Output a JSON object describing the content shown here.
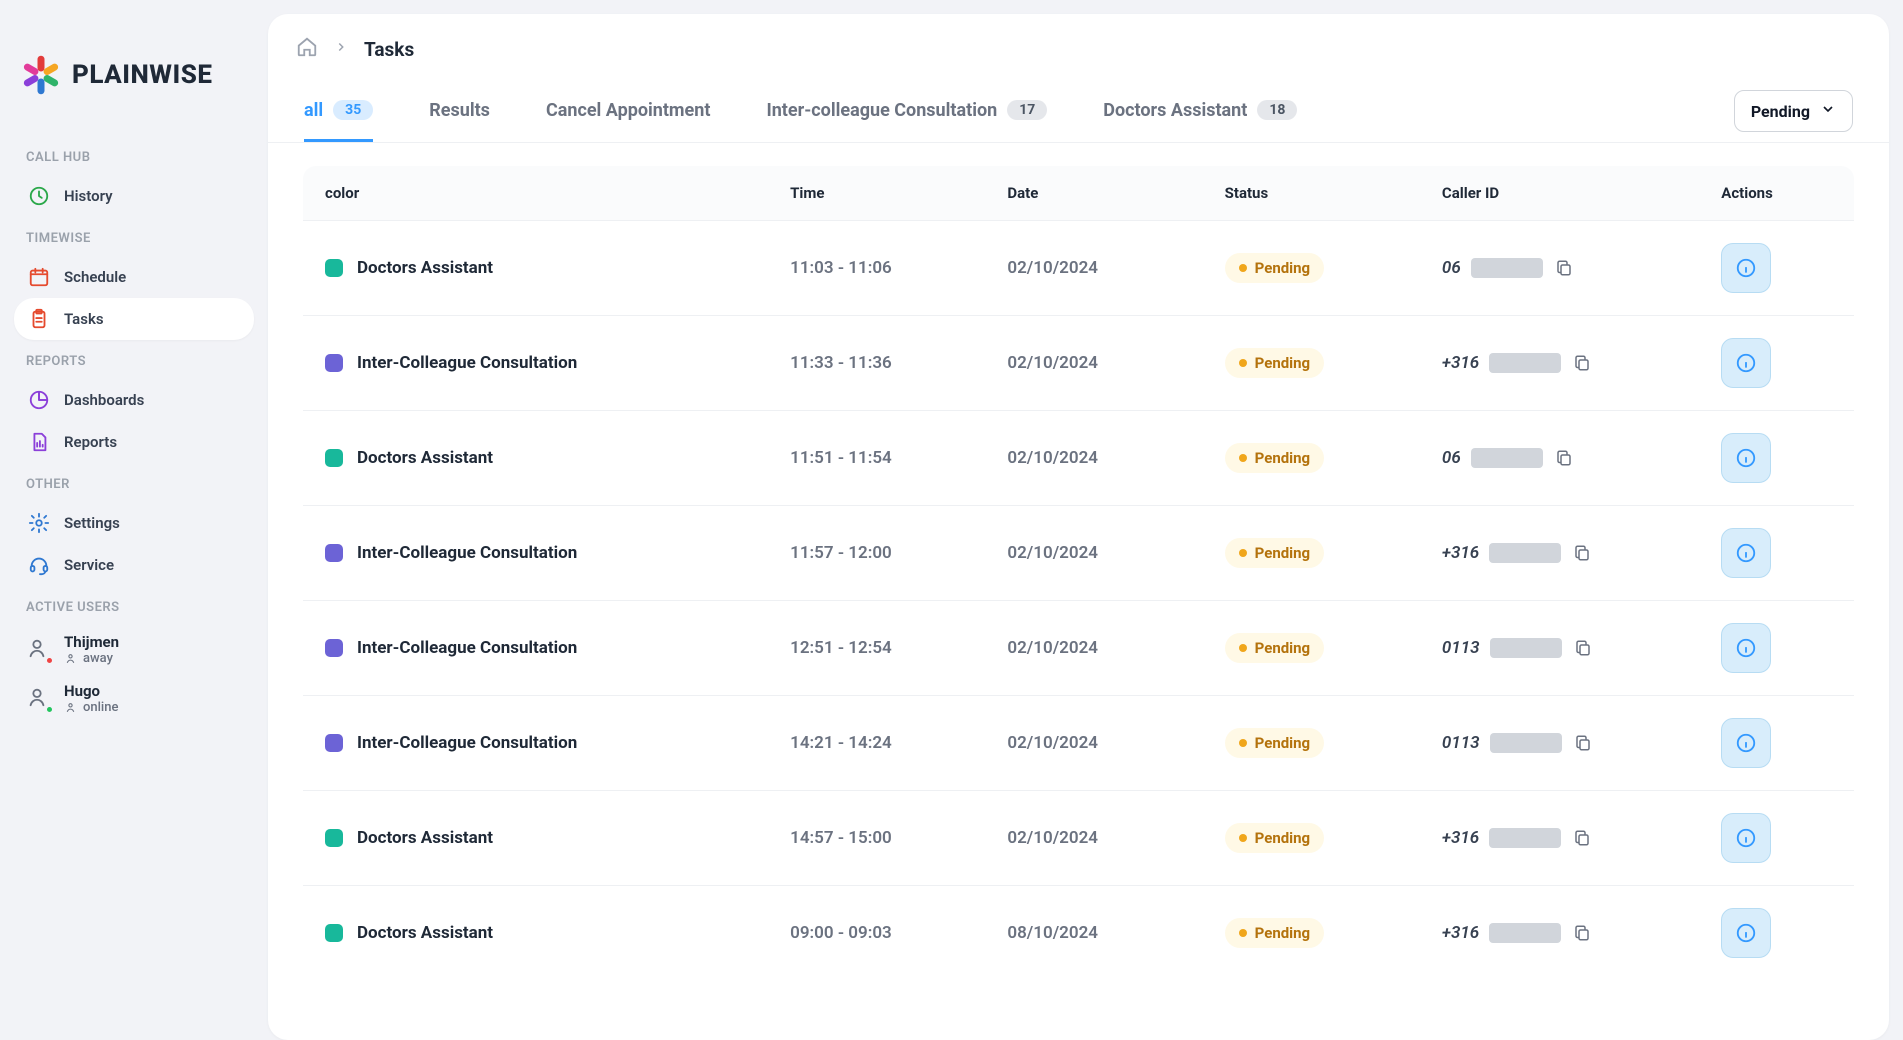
{
  "brand": {
    "name": "PLAINWISE"
  },
  "sidebar": {
    "sections": [
      {
        "label": "CALL HUB",
        "items": [
          {
            "label": "History",
            "icon": "clock",
            "color": "#2ba84a"
          }
        ]
      },
      {
        "label": "TIMEWISE",
        "items": [
          {
            "label": "Schedule",
            "icon": "calendar",
            "color": "#e54a2e"
          },
          {
            "label": "Tasks",
            "icon": "clipboard",
            "color": "#e54a2e",
            "active": true
          }
        ]
      },
      {
        "label": "REPORTS",
        "items": [
          {
            "label": "Dashboards",
            "icon": "piechart",
            "color": "#8b3fd9"
          },
          {
            "label": "Reports",
            "icon": "doc",
            "color": "#8b3fd9"
          }
        ]
      },
      {
        "label": "OTHER",
        "items": [
          {
            "label": "Settings",
            "icon": "gear",
            "color": "#2f78d1"
          },
          {
            "label": "Service",
            "icon": "headset",
            "color": "#2f78d1"
          }
        ]
      }
    ],
    "active_users_label": "ACTIVE USERS",
    "users": [
      {
        "name": "Thijmen",
        "status": "away",
        "status_color": "away"
      },
      {
        "name": "Hugo",
        "status": "online",
        "status_color": "online"
      }
    ]
  },
  "breadcrumb": {
    "current": "Tasks"
  },
  "tabs": [
    {
      "label": "all",
      "count": "35",
      "active": true
    },
    {
      "label": "Results"
    },
    {
      "label": "Cancel Appointment"
    },
    {
      "label": "Inter-colleague Consultation",
      "count": "17"
    },
    {
      "label": "Doctors Assistant",
      "count": "18"
    }
  ],
  "filter": {
    "label": "Pending"
  },
  "table": {
    "headers": [
      "color",
      "Time",
      "Date",
      "Status",
      "Caller ID",
      "Actions"
    ],
    "rows": [
      {
        "category": "Doctors Assistant",
        "color": "teal",
        "time": "11:03 - 11:06",
        "date": "02/10/2024",
        "status": "Pending",
        "caller_prefix": "06"
      },
      {
        "category": "Inter-Colleague Consultation",
        "color": "violet",
        "time": "11:33 - 11:36",
        "date": "02/10/2024",
        "status": "Pending",
        "caller_prefix": "+316"
      },
      {
        "category": "Doctors Assistant",
        "color": "teal",
        "time": "11:51 - 11:54",
        "date": "02/10/2024",
        "status": "Pending",
        "caller_prefix": "06"
      },
      {
        "category": "Inter-Colleague Consultation",
        "color": "violet",
        "time": "11:57 - 12:00",
        "date": "02/10/2024",
        "status": "Pending",
        "caller_prefix": "+316"
      },
      {
        "category": "Inter-Colleague Consultation",
        "color": "violet",
        "time": "12:51 - 12:54",
        "date": "02/10/2024",
        "status": "Pending",
        "caller_prefix": "0113"
      },
      {
        "category": "Inter-Colleague Consultation",
        "color": "violet",
        "time": "14:21 - 14:24",
        "date": "02/10/2024",
        "status": "Pending",
        "caller_prefix": "0113"
      },
      {
        "category": "Doctors Assistant",
        "color": "teal",
        "time": "14:57 - 15:00",
        "date": "02/10/2024",
        "status": "Pending",
        "caller_prefix": "+316"
      },
      {
        "category": "Doctors Assistant",
        "color": "teal",
        "time": "09:00 - 09:03",
        "date": "08/10/2024",
        "status": "Pending",
        "caller_prefix": "+316"
      }
    ]
  }
}
